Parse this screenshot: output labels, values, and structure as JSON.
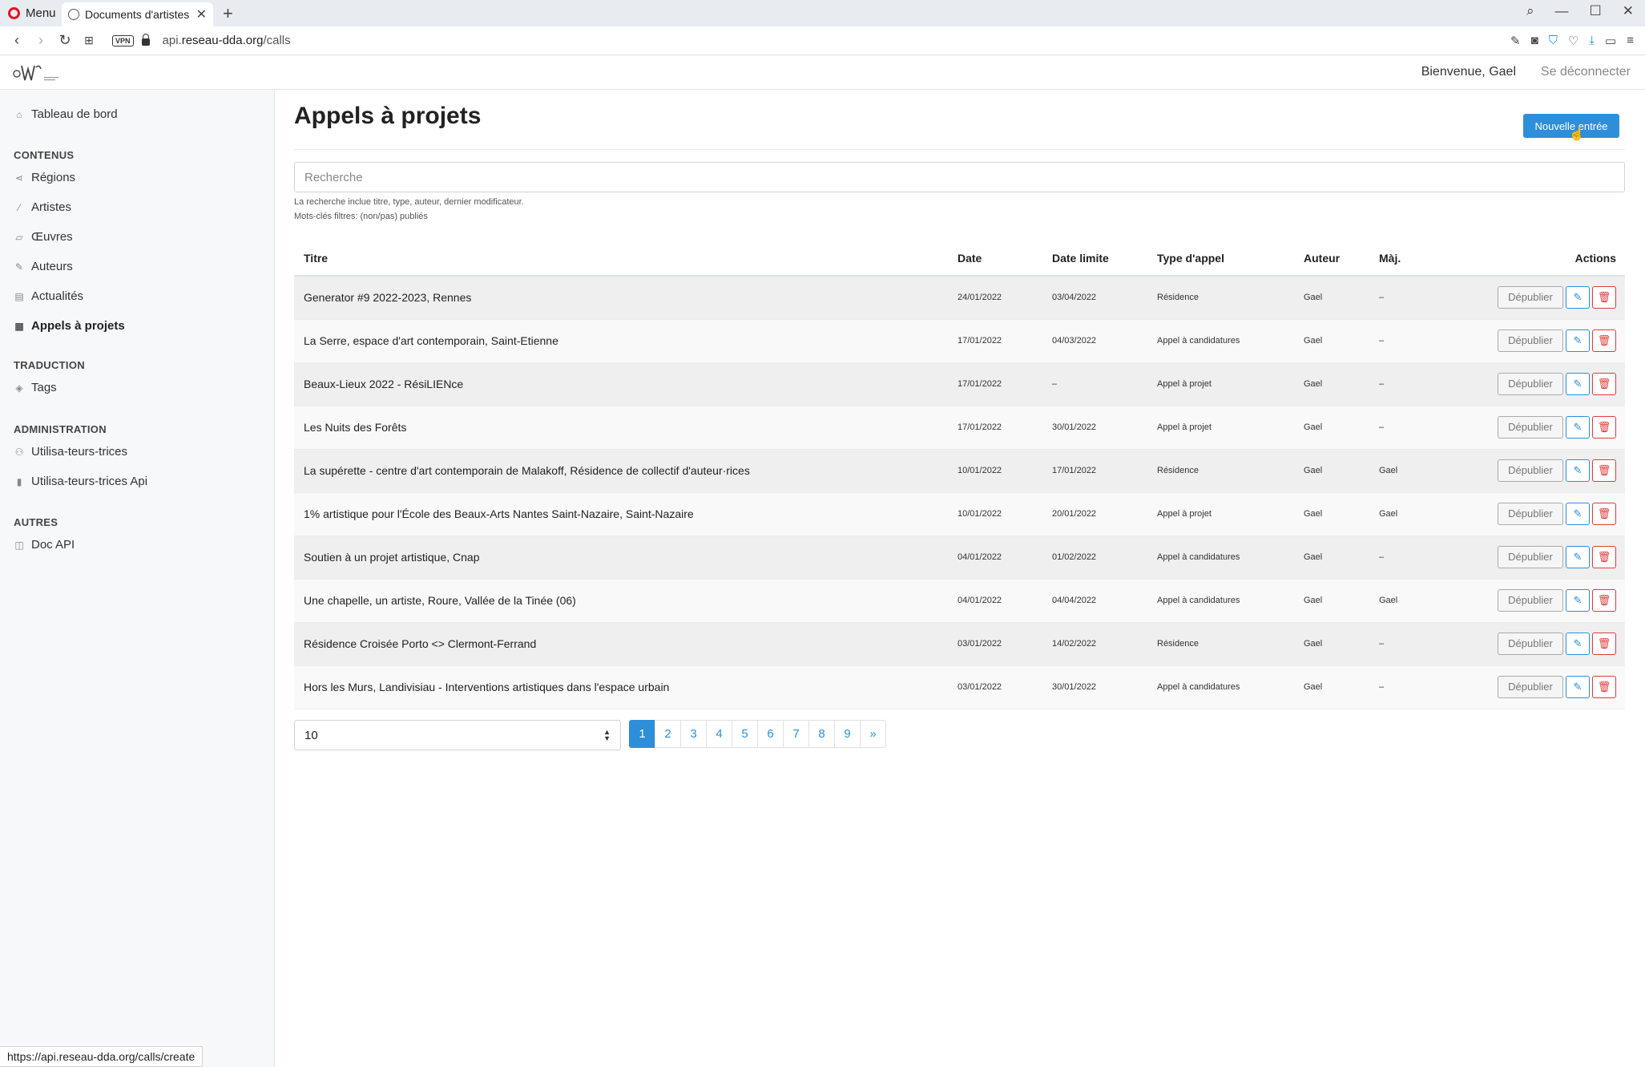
{
  "browser": {
    "menu_label": "Menu",
    "tab_title": "Documents d'artistes - A",
    "url_prefix": "api.",
    "url_domain": "reseau-dda.org",
    "url_path": "/calls",
    "status_url": "https://api.reseau-dda.org/calls/create"
  },
  "header": {
    "welcome": "Bienvenue, Gael",
    "logout": "Se déconnecter"
  },
  "sidebar": {
    "dashboard": "Tableau de bord",
    "sections": {
      "contents": "CONTENUS",
      "translation": "TRADUCTION",
      "administration": "ADMINISTRATION",
      "others": "AUTRES"
    },
    "items": {
      "regions": "Régions",
      "artists": "Artistes",
      "works": "Œuvres",
      "authors": "Auteurs",
      "news": "Actualités",
      "calls": "Appels à projets",
      "tags": "Tags",
      "users": "Utilisa-teurs-trices",
      "api_users": "Utilisa-teurs-trices Api",
      "api_doc": "Doc API"
    }
  },
  "main": {
    "title": "Appels à projets",
    "new_button": "Nouvelle entrée",
    "search_placeholder": "Recherche",
    "help_1": "La recherche inclue titre, type, auteur, dernier modificateur.",
    "help_2": "Mots-clés filtres: (non/pas) publiés"
  },
  "table": {
    "headers": {
      "title": "Titre",
      "date": "Date",
      "deadline": "Date limite",
      "type": "Type d'appel",
      "author": "Auteur",
      "updated": "Màj.",
      "actions": "Actions"
    },
    "unpublish_label": "Dépublier",
    "rows": [
      {
        "title": "Generator #9 2022-2023, Rennes",
        "date": "24/01/2022",
        "deadline": "03/04/2022",
        "type": "Résidence",
        "author": "Gael",
        "updated": "–"
      },
      {
        "title": "La Serre, espace d'art contemporain, Saint-Etienne",
        "date": "17/01/2022",
        "deadline": "04/03/2022",
        "type": "Appel à candidatures",
        "author": "Gael",
        "updated": "–"
      },
      {
        "title": "Beaux-Lieux 2022 - RésiLIENce",
        "date": "17/01/2022",
        "deadline": "–",
        "type": "Appel à projet",
        "author": "Gael",
        "updated": "–"
      },
      {
        "title": "Les Nuits des Forêts",
        "date": "17/01/2022",
        "deadline": "30/01/2022",
        "type": "Appel à projet",
        "author": "Gael",
        "updated": "–"
      },
      {
        "title": "La supérette - centre d'art contemporain de Malakoff, Résidence de collectif d'auteur·rices",
        "date": "10/01/2022",
        "deadline": "17/01/2022",
        "type": "Résidence",
        "author": "Gael",
        "updated": "Gael"
      },
      {
        "title": "1% artistique pour l'École des Beaux-Arts Nantes Saint-Nazaire, Saint-Nazaire",
        "date": "10/01/2022",
        "deadline": "20/01/2022",
        "type": "Appel à projet",
        "author": "Gael",
        "updated": "Gael"
      },
      {
        "title": "Soutien à un projet artistique, Cnap",
        "date": "04/01/2022",
        "deadline": "01/02/2022",
        "type": "Appel à candidatures",
        "author": "Gael",
        "updated": "–"
      },
      {
        "title": "Une chapelle, un artiste, Roure, Vallée de la Tinée (06)",
        "date": "04/01/2022",
        "deadline": "04/04/2022",
        "type": "Appel à candidatures",
        "author": "Gael",
        "updated": "Gael"
      },
      {
        "title": "Résidence Croisée Porto <> Clermont-Ferrand",
        "date": "03/01/2022",
        "deadline": "14/02/2022",
        "type": "Résidence",
        "author": "Gael",
        "updated": "–"
      },
      {
        "title": "Hors les Murs, Landivisiau - Interventions artistiques dans l'espace urbain",
        "date": "03/01/2022",
        "deadline": "30/01/2022",
        "type": "Appel à candidatures",
        "author": "Gael",
        "updated": "–"
      }
    ]
  },
  "pagination": {
    "page_size": "10",
    "pages": [
      "1",
      "2",
      "3",
      "4",
      "5",
      "6",
      "7",
      "8",
      "9"
    ],
    "next": "»",
    "current": "1"
  },
  "colors": {
    "accent": "#2d8fd9",
    "danger": "#e03b3b"
  }
}
